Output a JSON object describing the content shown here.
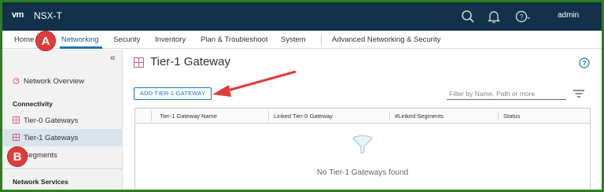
{
  "header": {
    "logo": "vm",
    "product": "NSX-T",
    "user": "admin",
    "icons": [
      "search-icon",
      "bell-icon",
      "help-icon"
    ]
  },
  "nav": {
    "tabs": [
      {
        "label": "Home"
      },
      {
        "label": "Networking",
        "active": true
      },
      {
        "label": "Security"
      },
      {
        "label": "Inventory"
      },
      {
        "label": "Plan & Troubleshoot"
      },
      {
        "label": "System"
      },
      {
        "label": "Advanced Networking & Security"
      }
    ]
  },
  "sidebar": {
    "collapse": "«",
    "overview": "Network Overview",
    "section_connectivity": "Connectivity",
    "items": [
      {
        "label": "Tier-0 Gateways"
      },
      {
        "label": "Tier-1 Gateways",
        "selected": true
      },
      {
        "label": "Segments"
      }
    ],
    "section_services": "Network Services"
  },
  "main": {
    "title": "Tier-1 Gateway",
    "add_button": "ADD TIER-1 GATEWAY",
    "filter_placeholder": "Filter by Name, Path or more",
    "columns": [
      "Tier-1 Gateway Name",
      "Linked Tier-0 Gateway",
      "#Linked Segments",
      "Status"
    ],
    "empty_message": "No Tier-1 Gateways found"
  },
  "annotations": {
    "a": "A",
    "b": "B",
    "color": "#e03c3c"
  }
}
